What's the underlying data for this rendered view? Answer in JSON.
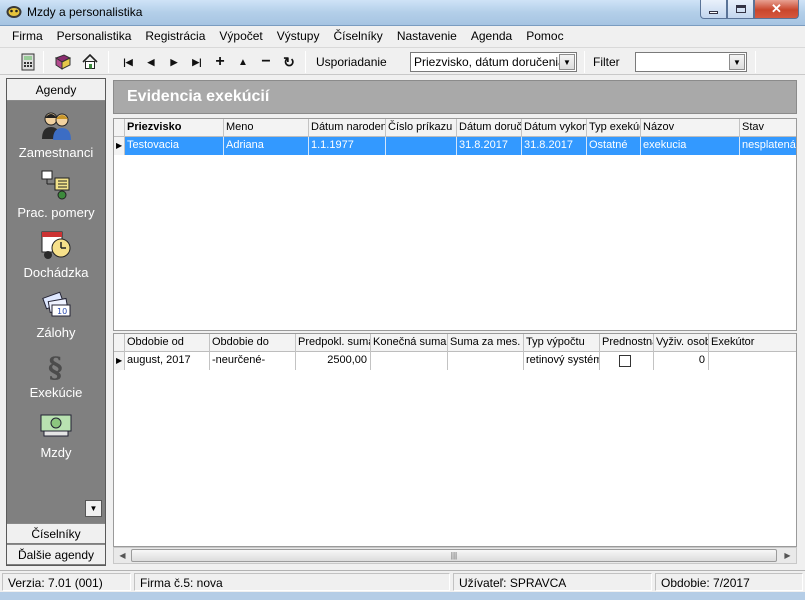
{
  "window": {
    "title": "Mzdy a personalistika"
  },
  "menu": [
    "Firma",
    "Personalistika",
    "Registrácia",
    "Výpočet",
    "Výstupy",
    "Číselníky",
    "Nastavenie",
    "Agenda",
    "Pomoc"
  ],
  "toolbar": {
    "first": "|◀",
    "prev": "◀",
    "next": "▶",
    "last": "▶|",
    "add": "+",
    "up": "▲",
    "remove": "−",
    "refresh": "↻",
    "sort_label": "Usporiadanie",
    "sort_value": "Priezvisko, dátum doručenia",
    "filter_label": "Filter",
    "filter_value": ""
  },
  "sidebar": {
    "header": "Agendy",
    "items": [
      {
        "label": "Zamestnanci",
        "icon": "employees-icon"
      },
      {
        "label": "Prac. pomery",
        "icon": "work-relations-icon"
      },
      {
        "label": "Dochádzka",
        "icon": "attendance-icon"
      },
      {
        "label": "Zálohy",
        "icon": "advances-icon"
      },
      {
        "label": "Exekúcie",
        "icon": "executions-icon"
      },
      {
        "label": "Mzdy",
        "icon": "wages-icon"
      }
    ],
    "footer1": "Číselníky",
    "footer2": "Ďalšie agendy"
  },
  "banner": {
    "title": "Evidencia exekúcií"
  },
  "top_grid": {
    "columns": [
      "Priezvisko",
      "Meno",
      "Dátum narodenia",
      "Číslo príkazu",
      "Dátum doručenia",
      "Dátum vykonateľnosti",
      "Typ exekúcie",
      "Názov",
      "Stav"
    ],
    "row": [
      "Testovacia",
      "Adriana",
      "1.1.1977",
      "",
      "31.8.2017",
      "31.8.2017",
      "Ostatné",
      "exekucia",
      "nesplatená"
    ]
  },
  "bottom_grid": {
    "columns": [
      "Obdobie od",
      "Obdobie do",
      "Predpokl. suma",
      "Konečná suma",
      "Suma za mes.",
      "Typ výpočtu",
      "Prednostná",
      "Vyživ. osoby",
      "Exekútor"
    ],
    "row": [
      "august, 2017",
      "-neurčené-",
      "2500,00",
      "",
      "",
      "retinový systém",
      "",
      "0",
      ""
    ]
  },
  "status": {
    "version": "Verzia: 7.01 (001)",
    "company": "Firma č.5: nova",
    "user": "Užívateľ: SPRAVCA",
    "period": "Obdobie: 7/2017"
  },
  "colors": {
    "selection": "#3399ff",
    "sidebar_bg": "#808080",
    "banner_bg": "#a9a9a9"
  }
}
